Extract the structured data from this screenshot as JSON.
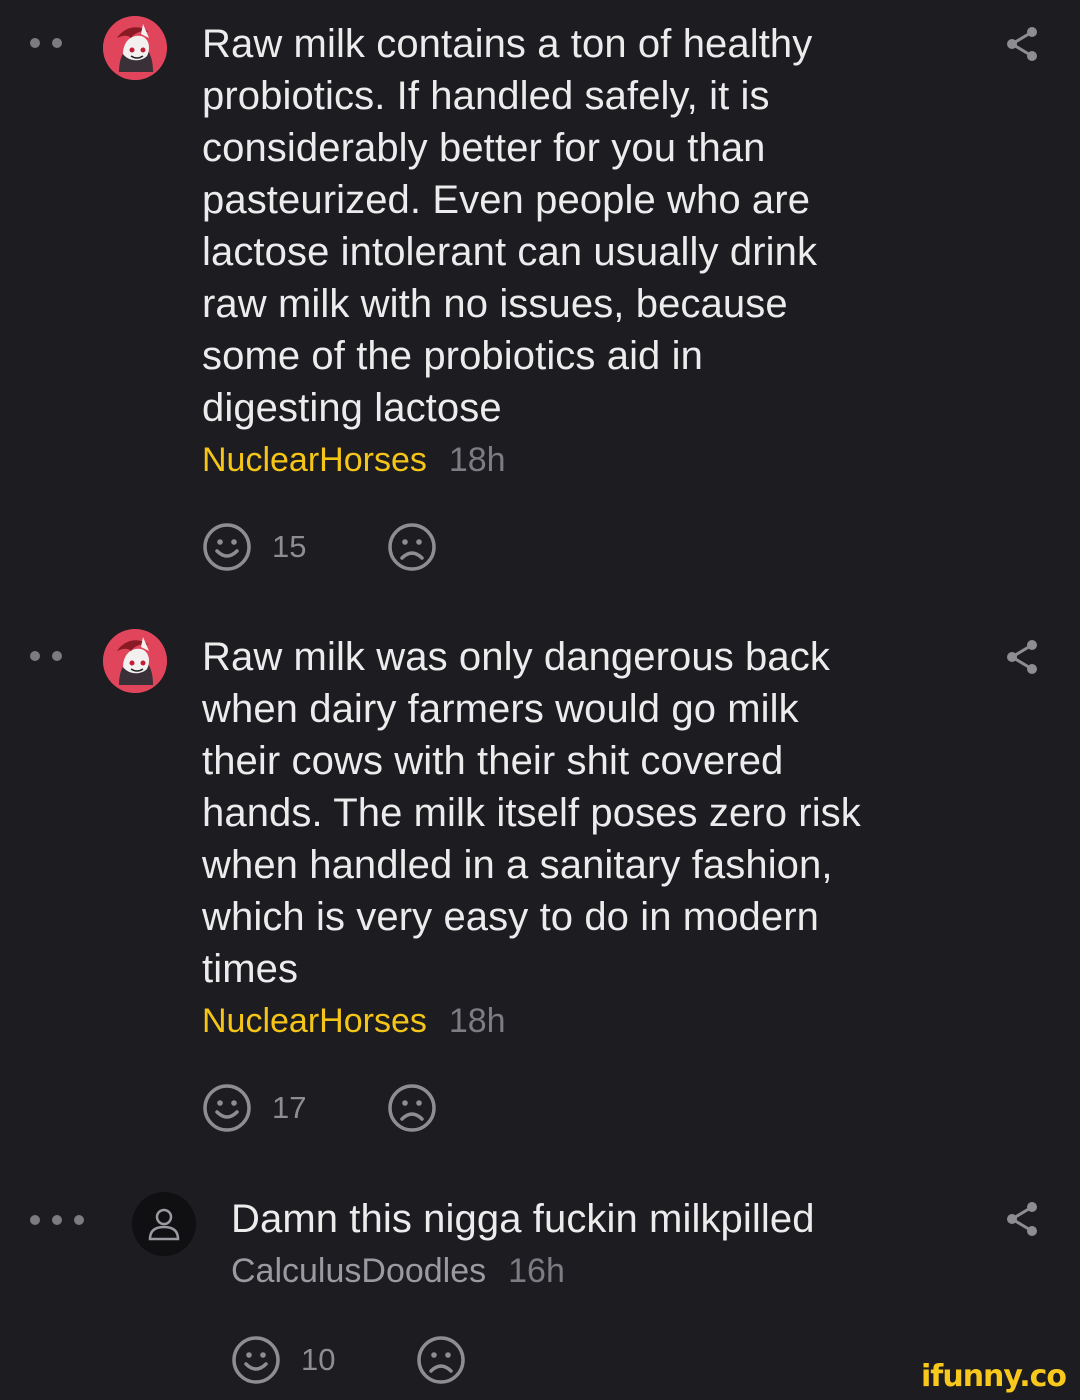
{
  "comments": [
    {
      "text": "Raw milk contains a ton of healthy\nprobiotics. If handled safely, it is\nconsiderably better for you than\npasteurized. Even people who are\nlactose intolerant can usually drink\nraw milk with no issues, because\nsome of the probiotics aid in\ndigesting lactose",
      "author": "NuclearHorses",
      "time": "18h",
      "smile_count": "15",
      "avatar": "pony-avatar",
      "depth_dots": 2
    },
    {
      "text": "Raw milk was only dangerous back\nwhen dairy farmers would go milk\ntheir cows with their shit covered\nhands. The milk itself poses zero risk\nwhen handled in a sanitary fashion,\nwhich is very easy to do in modern\ntimes",
      "author": "NuclearHorses",
      "time": "18h",
      "smile_count": "17",
      "avatar": "pony-avatar",
      "depth_dots": 2
    },
    {
      "text": "Damn this nigga fuckin milkpilled",
      "author": "CalculusDoodles",
      "time": "16h",
      "smile_count": "10",
      "avatar": "default-user-avatar",
      "depth_dots": 3
    }
  ],
  "icons": {
    "smile": "smile-icon",
    "frown": "frown-icon",
    "share": "share-icon"
  },
  "colors": {
    "background": "#1c1c21",
    "author": "#f5c518",
    "muted": "#7c7c82",
    "avatar_accent": "#e0455b",
    "watermark": "#f8c81c"
  },
  "watermark": "ifunny.co"
}
